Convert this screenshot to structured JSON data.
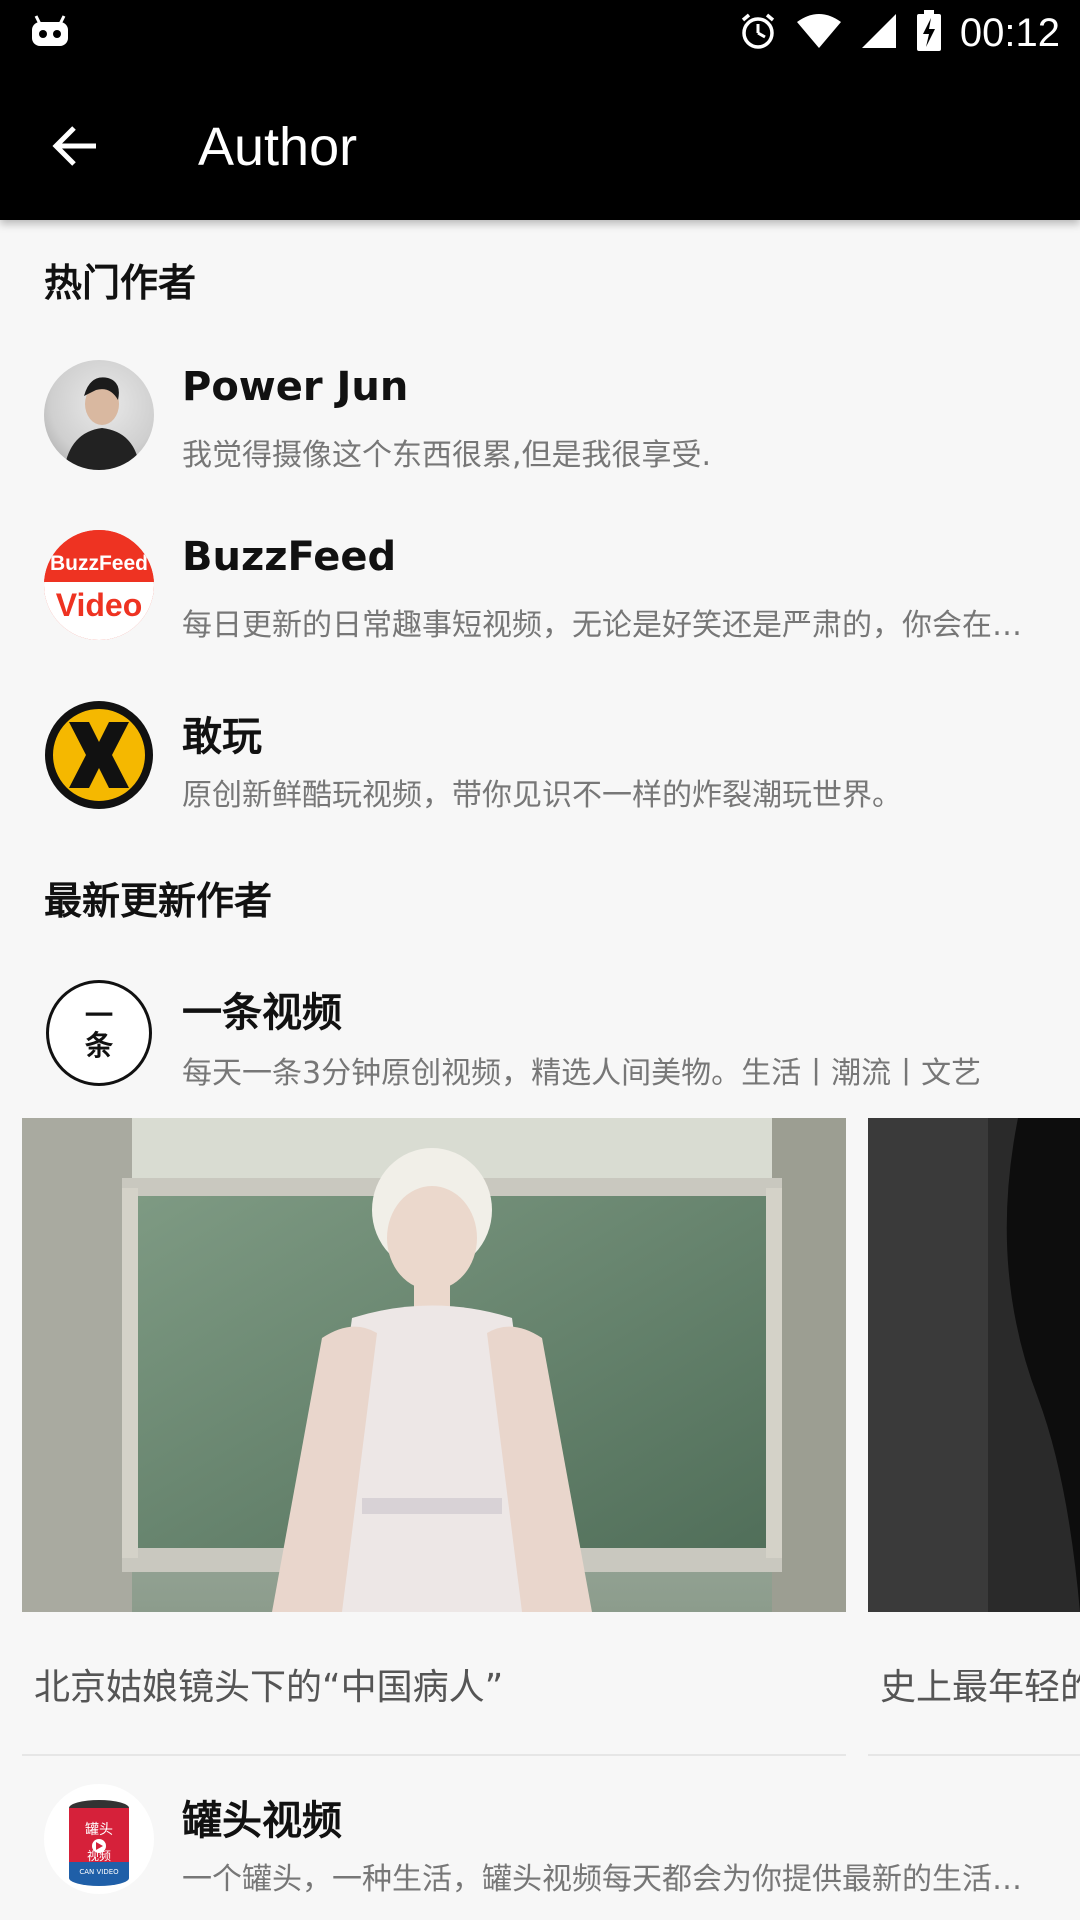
{
  "status_bar": {
    "time": "00:12",
    "icons": [
      "android-debug-icon",
      "alarm-icon",
      "wifi-icon",
      "signal-icon",
      "battery-charging-icon"
    ]
  },
  "toolbar": {
    "back_icon": "arrow-back-icon",
    "title": "Author"
  },
  "sections": {
    "popular_title": "热门作者",
    "latest_title": "最新更新作者"
  },
  "popular_authors": [
    {
      "name": "Power Jun",
      "desc": "我觉得摄像这个东西很累,但是我很享受."
    },
    {
      "name": "BuzzFeed",
      "desc": "每日更新的日常趣事短视频，无论是好笑还是严肃的，你会在这里找到最棒的视频",
      "logo_top": "BuzzFeed",
      "logo_bottom": "Video"
    },
    {
      "name": "敢玩",
      "desc": "原创新鲜酷玩视频，带你见识不一样的炸裂潮玩世界。",
      "logo_text": "X"
    }
  ],
  "latest_authors": [
    {
      "name": "一条视频",
      "desc": "每天一条3分钟原创视频，精选人间美物。生活丨潮流丨文艺",
      "logo_text_top": "一",
      "logo_text_bottom": "条",
      "videos": [
        {
          "caption": "北京姑娘镜头下的“中国病人”"
        },
        {
          "caption": "史上最年轻的"
        }
      ]
    },
    {
      "name": "罐头视频",
      "desc": "一个罐头，一种生活，罐头视频每天都会为你提供最新的生活方式",
      "logo_text_top": "罐头",
      "logo_text_mid": "视频",
      "logo_text_bottom": "CAN VIDEO"
    }
  ],
  "colors": {
    "bar": "#000000",
    "background": "#f7f7f7",
    "buzzfeed_red": "#ee3322",
    "ganwan_yellow": "#f5b800"
  }
}
